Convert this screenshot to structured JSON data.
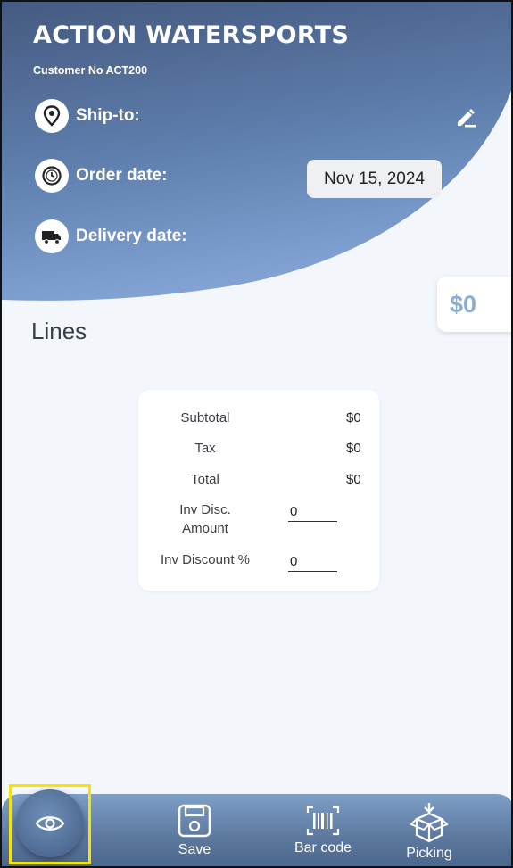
{
  "customer": {
    "name": "ACTION WATERSPORTS",
    "number_line": "Customer No ACT200"
  },
  "header_rows": {
    "ship_to_label": "Ship-to:",
    "order_date_label": "Order date:",
    "order_date_value": "Nov 15, 2024",
    "delivery_date_label": "Delivery date:"
  },
  "order_total_badge": "$0",
  "lines_title": "Lines",
  "totals": {
    "subtotal_label": "Subtotal",
    "subtotal_value": "$0",
    "tax_label": "Tax",
    "tax_value": "$0",
    "total_label": "Total",
    "total_value": "$0",
    "inv_disc_amount_label_1": "Inv Disc.",
    "inv_disc_amount_label_2": "Amount",
    "inv_disc_amount_value": "0",
    "inv_discount_pct_label": "Inv Discount %",
    "inv_discount_pct_value": "0"
  },
  "bottom_nav": {
    "save_label": "Save",
    "barcode_label": "Bar code",
    "picking_label": "Picking"
  },
  "icons": {
    "ship_to": "location-pin-icon",
    "order_date": "clock-icon",
    "delivery_date": "truck-icon",
    "edit": "pencil-icon",
    "view": "eye-icon",
    "save": "floppy-disk-icon",
    "barcode": "barcode-icon",
    "picking": "box-icon"
  },
  "colors": {
    "header_dark": "#4a6086",
    "header_light": "#7f9fce",
    "accent_amount": "#8aaed3",
    "highlight": "#f5e400"
  }
}
